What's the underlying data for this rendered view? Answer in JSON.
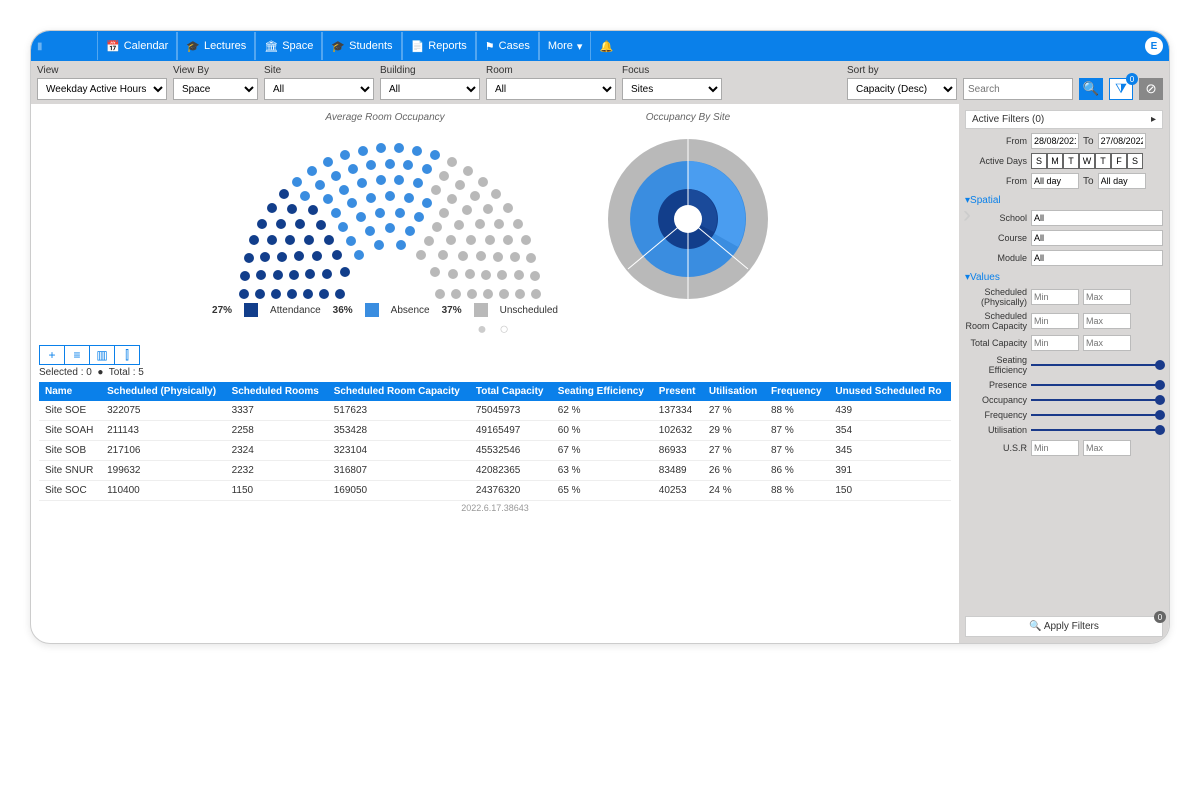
{
  "nav": [
    "Calendar",
    "Lectures",
    "Space",
    "Students",
    "Reports",
    "Cases",
    "More"
  ],
  "user_badge": "E",
  "filters": {
    "view": {
      "label": "View",
      "value": "Weekday Active Hours"
    },
    "viewby": {
      "label": "View By",
      "value": "Space"
    },
    "site": {
      "label": "Site",
      "value": "All"
    },
    "building": {
      "label": "Building",
      "value": "All"
    },
    "room": {
      "label": "Room",
      "value": "All"
    },
    "focus": {
      "label": "Focus",
      "value": "Sites"
    },
    "sortby": {
      "label": "Sort by",
      "value": "Capacity (Desc)"
    },
    "search_ph": "Search"
  },
  "chart_data": [
    {
      "type": "pie",
      "title": "Average Room Occupancy",
      "series": [
        {
          "name": "Attendance",
          "value": 27,
          "color": "#123e8b"
        },
        {
          "name": "Absence",
          "value": 36,
          "color": "#3a8de0"
        },
        {
          "name": "Unscheduled",
          "value": 37,
          "color": "#b9b9b9"
        }
      ]
    },
    {
      "type": "pie",
      "title": "Occupancy By Site",
      "note": "sunburst rings approximate proportions",
      "series": [
        {
          "name": "inner-dark",
          "value": 30,
          "color": "#123e8b"
        },
        {
          "name": "mid-blue",
          "value": 40,
          "color": "#3a8de0"
        },
        {
          "name": "outer-gray",
          "value": 30,
          "color": "#b9b9b9"
        }
      ]
    }
  ],
  "legend_labels": {
    "att": "Attendance",
    "abs": "Absence",
    "uns": "Unscheduled"
  },
  "selection": {
    "selected": "Selected : 0",
    "total": "Total : 5"
  },
  "table": {
    "columns": [
      "Name",
      "Scheduled (Physically)",
      "Scheduled Rooms",
      "Scheduled Room Capacity",
      "Total Capacity",
      "Seating Efficiency",
      "Present",
      "Utilisation",
      "Frequency",
      "Unused Scheduled Ro"
    ],
    "rows": [
      [
        "Site SOE",
        "322075",
        "3337",
        "517623",
        "75045973",
        "62 %",
        "137334",
        "27 %",
        "88 %",
        "439"
      ],
      [
        "Site SOAH",
        "211143",
        "2258",
        "353428",
        "49165497",
        "60 %",
        "102632",
        "29 %",
        "87 %",
        "354"
      ],
      [
        "Site SOB",
        "217106",
        "2324",
        "323104",
        "45532546",
        "67 %",
        "86933",
        "27 %",
        "87 %",
        "345"
      ],
      [
        "Site SNUR",
        "199632",
        "2232",
        "316807",
        "42082365",
        "63 %",
        "83489",
        "26 %",
        "86 %",
        "391"
      ],
      [
        "Site SOC",
        "110400",
        "1150",
        "169050",
        "24376320",
        "65 %",
        "40253",
        "24 %",
        "88 %",
        "150"
      ]
    ]
  },
  "version": "2022.6.17.38643",
  "side": {
    "active_filters": "Active Filters (0)",
    "from_lbl": "From",
    "to_lbl": "To",
    "from_date": "28/08/2021",
    "to_date": "27/08/2022",
    "active_days_lbl": "Active Days",
    "days": [
      "S",
      "M",
      "T",
      "W",
      "T",
      "F",
      "S"
    ],
    "from_time": "All day",
    "to_time": "All day",
    "spatial": "Spatial",
    "school": "School",
    "course": "Course",
    "module": "Module",
    "all": "All",
    "values": "Values",
    "sched_phys": "Scheduled (Physically)",
    "sched_cap": "Scheduled Room Capacity",
    "total_cap": "Total Capacity",
    "min": "Min",
    "max": "Max",
    "seating": "Seating Efficiency",
    "presence": "Presence",
    "occupancy": "Occupancy",
    "frequency": "Frequency",
    "utilisation": "Utilisation",
    "usr": "U.S.R",
    "apply": "Apply Filters",
    "apply_count": "0"
  }
}
